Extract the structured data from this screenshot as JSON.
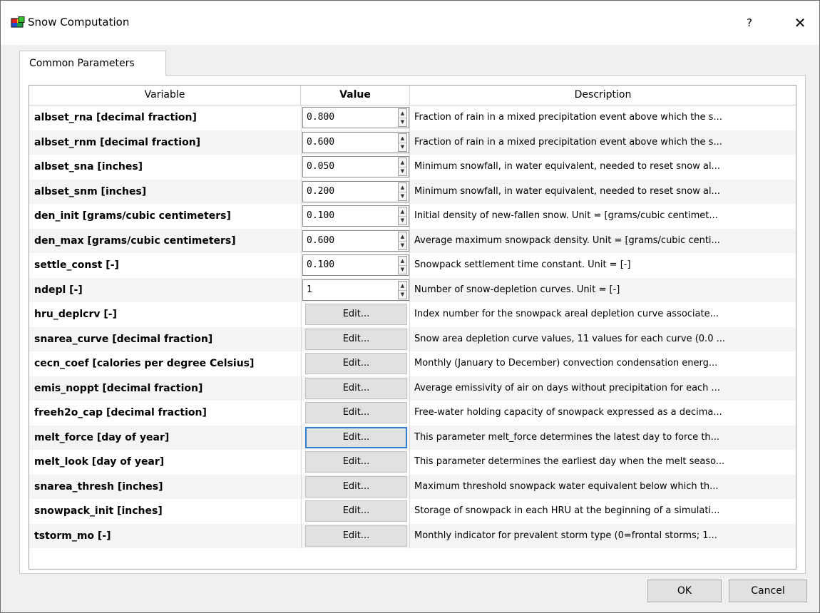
{
  "window": {
    "title": "Snow Computation",
    "help": "?",
    "close": "✕"
  },
  "tabs": [
    {
      "label": "Common Parameters"
    }
  ],
  "table": {
    "headers": {
      "variable": "Variable",
      "value": "Value",
      "description": "Description"
    },
    "rows": [
      {
        "variable": "albset_rna [decimal fraction]",
        "type": "spin",
        "value": "0.800",
        "description": "Fraction of rain in a mixed precipitation event above which the s..."
      },
      {
        "variable": "albset_rnm [decimal fraction]",
        "type": "spin",
        "value": "0.600",
        "description": "Fraction of rain in a mixed precipitation event above which the s..."
      },
      {
        "variable": "albset_sna [inches]",
        "type": "spin",
        "value": "0.050",
        "description": "Minimum snowfall, in water equivalent, needed to reset snow al..."
      },
      {
        "variable": "albset_snm [inches]",
        "type": "spin",
        "value": "0.200",
        "description": "Minimum snowfall, in water equivalent, needed to reset snow al..."
      },
      {
        "variable": "den_init [grams/cubic centimeters]",
        "type": "spin",
        "value": "0.100",
        "description": "Initial density of new-fallen snow. Unit = [grams/cubic centimet..."
      },
      {
        "variable": "den_max [grams/cubic centimeters]",
        "type": "spin",
        "value": "0.600",
        "description": "Average maximum snowpack density. Unit = [grams/cubic centi..."
      },
      {
        "variable": "settle_const [-]",
        "type": "spin",
        "value": "0.100",
        "description": "Snowpack settlement time constant. Unit = [-]"
      },
      {
        "variable": "ndepl [-]",
        "type": "spin",
        "value": "1",
        "description": "Number of snow-depletion curves. Unit = [-]"
      },
      {
        "variable": "hru_deplcrv [-]",
        "type": "edit",
        "value": "Edit...",
        "description": "Index number for the snowpack areal depletion curve associate..."
      },
      {
        "variable": "snarea_curve [decimal fraction]",
        "type": "edit",
        "value": "Edit...",
        "description": "Snow area depletion curve values, 11 values for each curve (0.0 ..."
      },
      {
        "variable": "cecn_coef [calories per degree Celsius]",
        "type": "edit",
        "value": "Edit...",
        "description": "Monthly (January to December) convection condensation energ..."
      },
      {
        "variable": "emis_noppt [decimal fraction]",
        "type": "edit",
        "value": "Edit...",
        "description": "Average emissivity of air on days without precipitation for each ..."
      },
      {
        "variable": "freeh2o_cap [decimal fraction]",
        "type": "edit",
        "value": "Edit...",
        "description": "Free-water holding capacity of snowpack expressed as a decima..."
      },
      {
        "variable": "melt_force [day of year]",
        "type": "edit",
        "value": "Edit...",
        "focused": true,
        "description": "This parameter melt_force determines the latest day to force th..."
      },
      {
        "variable": "melt_look [day of year]",
        "type": "edit",
        "value": "Edit...",
        "description": "This parameter determines the earliest day when the melt seaso..."
      },
      {
        "variable": "snarea_thresh [inches]",
        "type": "edit",
        "value": "Edit...",
        "description": "Maximum threshold snowpack water equivalent below which th..."
      },
      {
        "variable": "snowpack_init [inches]",
        "type": "edit",
        "value": "Edit...",
        "description": "Storage of snowpack in each HRU at the beginning of a simulati..."
      },
      {
        "variable": "tstorm_mo [-]",
        "type": "edit",
        "value": "Edit...",
        "description": "Monthly indicator for prevalent storm type (0=frontal storms; 1..."
      }
    ]
  },
  "buttons": {
    "ok": "OK",
    "cancel": "Cancel"
  }
}
